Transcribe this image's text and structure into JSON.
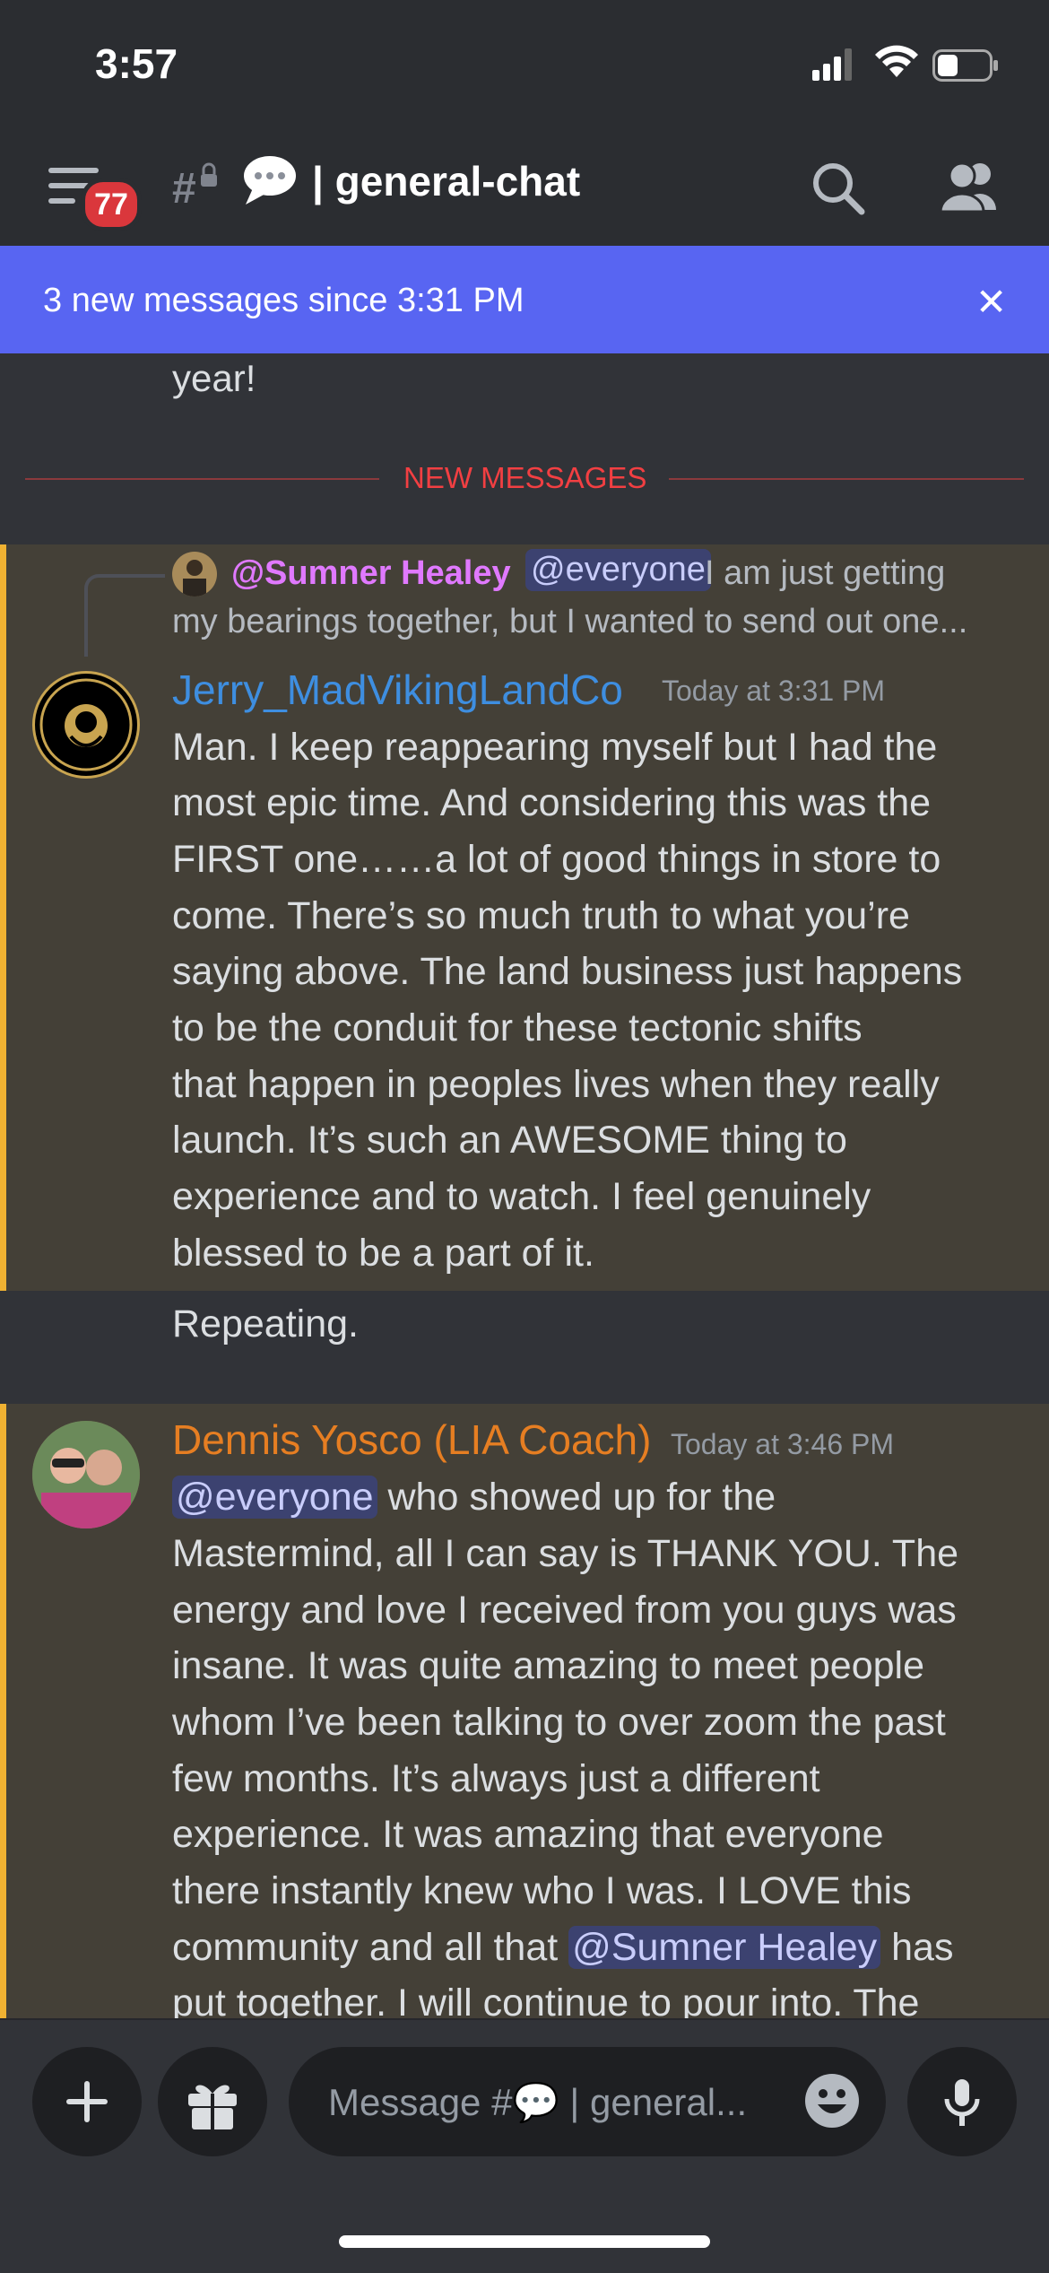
{
  "status_bar": {
    "time": "3:57",
    "icons": [
      "signal-icon",
      "wifi-icon",
      "battery-icon"
    ]
  },
  "header": {
    "menu_badge": "77",
    "channel_emoji": "💬",
    "channel_name": "| general-chat",
    "icons": [
      "hamburger-icon",
      "thread-lock-icon",
      "search-icon",
      "members-icon"
    ]
  },
  "banner": {
    "text": "3 new messages since 3:31 PM",
    "close": "✕"
  },
  "previous_message_tail": "year!",
  "divider": {
    "label": "NEW MESSAGES"
  },
  "messages": [
    {
      "reply": {
        "user": "@Sumner Healey",
        "mention": "@everyone",
        "text_line1": "I am just getting",
        "text_line2": "my bearings together, but I wanted to send out one..."
      },
      "author": "Jerry_MadVikingLandCo",
      "timestamp": "Today at 3:31 PM",
      "lines": [
        "Man.  I keep reappearing myself but I had the",
        "most epic time.  And considering this was the",
        "FIRST one……a lot of good things in store to",
        "come.  There’s so much truth to what you’re",
        "saying above.  The land business just happens",
        "to be the conduit for these tectonic shifts",
        "that happen in peoples lives when they really",
        "launch.  It’s such an AWESOME thing to",
        "experience and to watch.   I feel genuinely",
        "blessed to be a part of it."
      ]
    },
    {
      "followup": "Repeating."
    },
    {
      "author": "Dennis Yosco (LIA Coach)",
      "timestamp": "Today at 3:46 PM",
      "mention_start": "@everyone",
      "line1_rest": " who showed up for the",
      "lines": [
        "Mastermind, all I can say is THANK YOU. The",
        "energy and love I received from you guys was",
        "insane. It was quite amazing to meet people",
        "whom I’ve been talking to over zoom the past",
        "few months. It’s always just a different",
        "experience. It was amazing that everyone",
        "there instantly knew who I was. I LOVE this"
      ],
      "line9_start": "community and all that ",
      "line9_mention": "@Sumner Healey",
      "line9_end": " has",
      "line10": "put together. I will continue to pour into. The"
    }
  ],
  "composer": {
    "placeholder": "Message #💬 | general...",
    "buttons": [
      "plus-icon",
      "gift-icon",
      "emoji-icon",
      "microphone-icon"
    ]
  },
  "colors": {
    "accent": "#5865f2",
    "highlight": "#444037",
    "highlight_bar": "#f0b232",
    "new_messages": "#f23f42",
    "author1": "#3e8ee0",
    "author2": "#e67e22"
  }
}
